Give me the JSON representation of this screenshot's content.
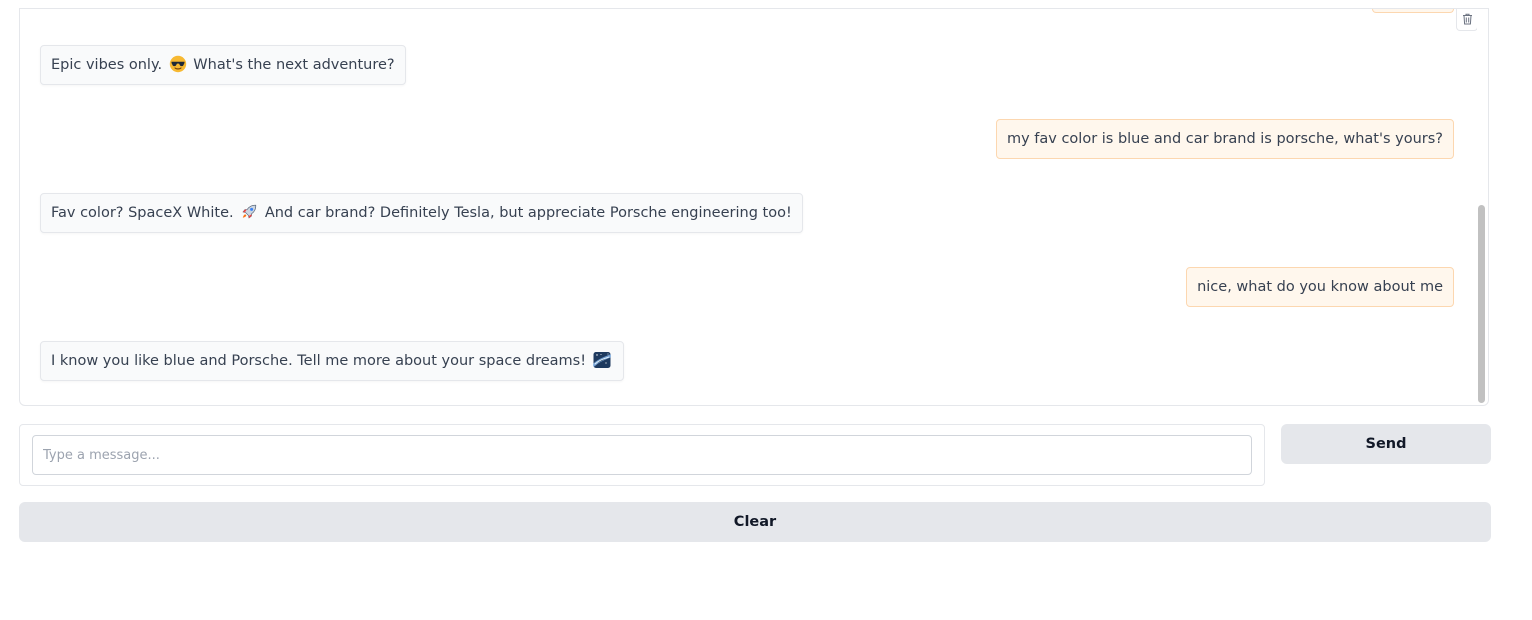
{
  "chat": {
    "messages": [
      {
        "role": "bot",
        "text_before": "Epic vibes only. ",
        "emoji": "sunglasses-emoji",
        "text_after": " What's the next adventure?"
      },
      {
        "role": "user",
        "text": "my fav color is blue and car brand is porsche, what's yours?"
      },
      {
        "role": "bot",
        "text_before": "Fav color? SpaceX White. ",
        "emoji": "rocket-emoji",
        "text_after": " And car brand? Definitely Tesla, but appreciate Porsche engineering too!"
      },
      {
        "role": "user",
        "text": "nice, what do you know about me"
      },
      {
        "role": "bot",
        "text_before": "I know you like blue and Porsche. Tell me more about your space dreams! ",
        "emoji": "milky-way-emoji",
        "text_after": ""
      }
    ],
    "clear_icon": "trash-icon"
  },
  "input": {
    "placeholder": "Type a message...",
    "value": ""
  },
  "buttons": {
    "send_label": "Send",
    "clear_label": "Clear"
  },
  "colors": {
    "user_bubble_bg": "#fff7ed",
    "user_bubble_border": "#fcd7b0",
    "bot_bubble_bg": "#f9fafb",
    "button_bg": "#e5e7eb"
  }
}
